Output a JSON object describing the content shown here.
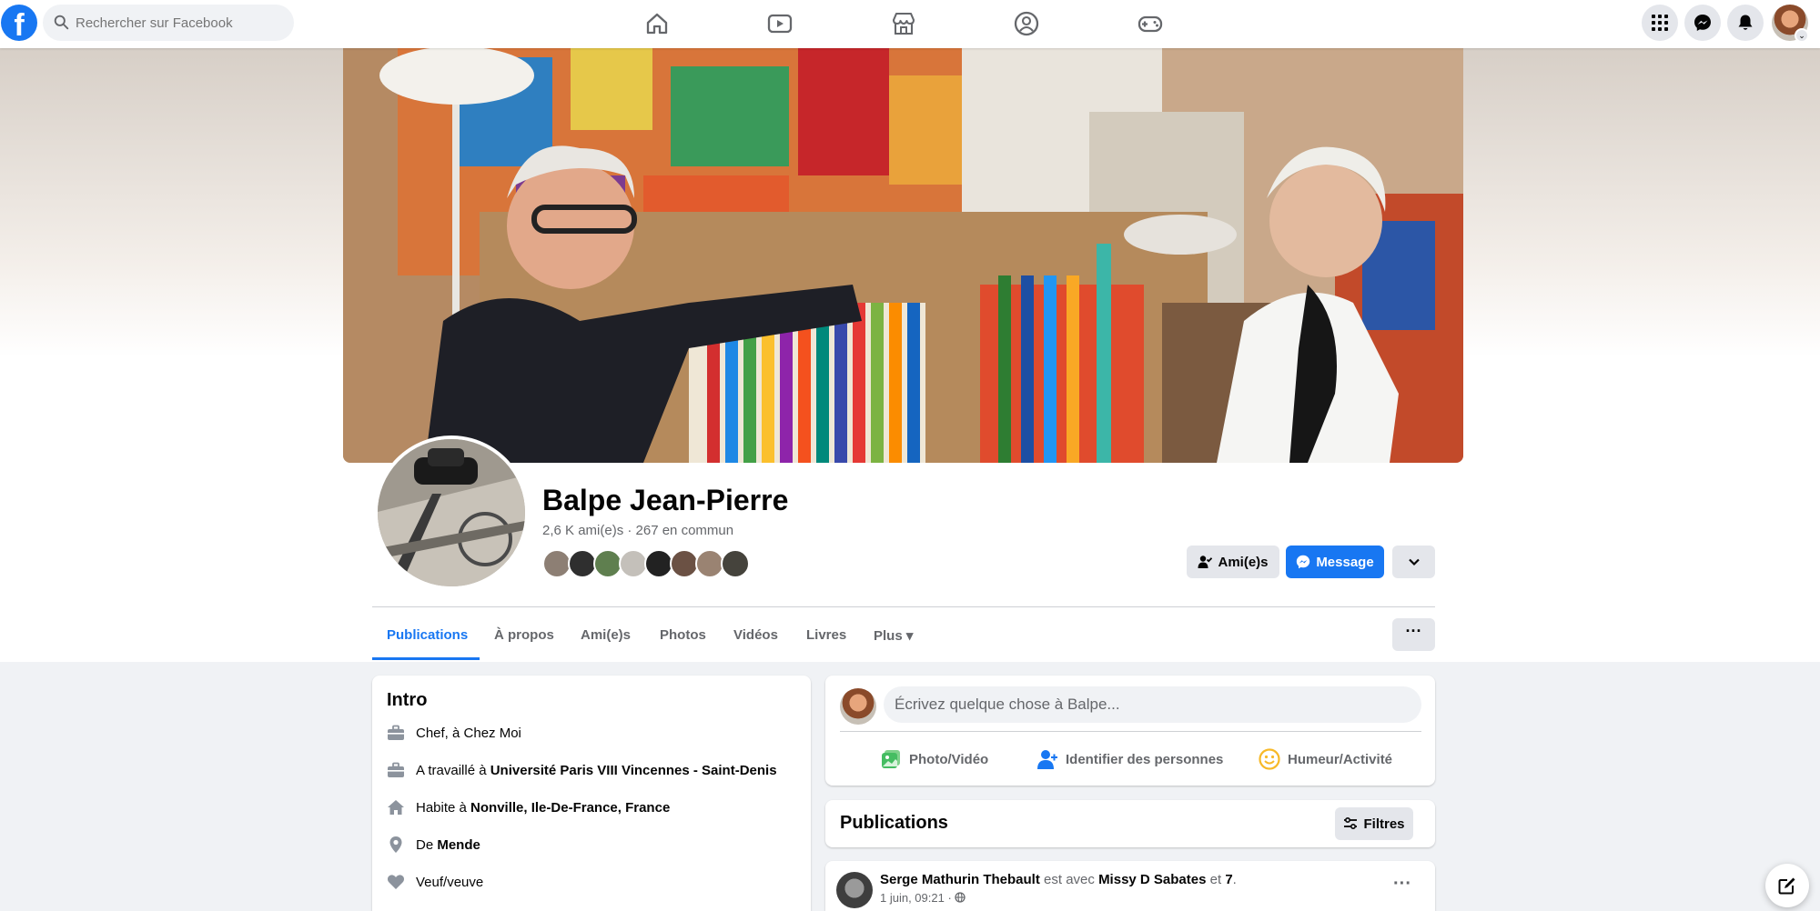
{
  "search": {
    "placeholder": "Rechercher sur Facebook"
  },
  "nav_icons": [
    "home-icon",
    "video-icon",
    "marketplace-icon",
    "groups-icon",
    "gaming-icon"
  ],
  "right_icons": [
    "menu-grid-icon",
    "messenger-icon",
    "bell-icon",
    "account-avatar"
  ],
  "profile": {
    "name": "Balpe Jean-Pierre",
    "friends_summary": "2,6 K ami(e)s · 267 en commun"
  },
  "actions": {
    "friends_label": "Ami(e)s",
    "message_label": "Message"
  },
  "tabs": [
    {
      "label": "Publications",
      "active": true
    },
    {
      "label": "À propos"
    },
    {
      "label": "Ami(e)s"
    },
    {
      "label": "Photos"
    },
    {
      "label": "Vidéos"
    },
    {
      "label": "Livres"
    },
    {
      "label": "Plus ▾"
    }
  ],
  "intro": {
    "title": "Intro",
    "rows": [
      {
        "icon": "briefcase-icon",
        "prefix": "Chef, à Chez Moi",
        "bold": ""
      },
      {
        "icon": "briefcase-icon",
        "prefix": "A travaillé à ",
        "bold": "Université Paris VIII Vincennes - Saint-Denis"
      },
      {
        "icon": "house-icon",
        "prefix": "Habite à ",
        "bold": "Nonville, Ile-De-France, France"
      },
      {
        "icon": "location-pin-icon",
        "prefix": "De ",
        "bold": "Mende"
      },
      {
        "icon": "heart-icon",
        "prefix": "Veuf/veuve",
        "bold": ""
      }
    ]
  },
  "composer": {
    "placeholder": "Écrivez quelque chose à Balpe...",
    "photo_label": "Photo/Vidéo",
    "tag_label": "Identifier des personnes",
    "mood_label": "Humeur/Activité"
  },
  "publications": {
    "title": "Publications",
    "filter_label": "Filtres"
  },
  "post": {
    "author": "Serge Mathurin Thebault",
    "with_text": " est avec ",
    "tagged": "Missy D Sabates",
    "and_text": " et ",
    "others": "7",
    "end": ".",
    "time": "1 juin, 09:21 ·"
  },
  "colors": {
    "brand": "#1877f2",
    "button_grey": "#e4e6eb",
    "page_bg": "#f0f2f5",
    "secondary_text": "#65676b"
  }
}
